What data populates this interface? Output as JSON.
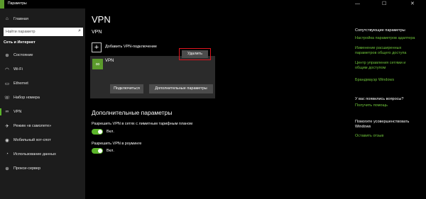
{
  "window": {
    "title": "Параметры",
    "minimize": "—",
    "maximize": "☐",
    "close": "✕"
  },
  "sidebar": {
    "home": "Главная",
    "search_placeholder": "Найти параметр",
    "section": "Сеть и Интернет",
    "items": [
      {
        "label": "Состояние",
        "icon": "globe-icon",
        "active": false
      },
      {
        "label": "Wi-Fi",
        "icon": "wifi-icon",
        "active": false
      },
      {
        "label": "Ethernet",
        "icon": "ethernet-icon",
        "active": false
      },
      {
        "label": "Набор номера",
        "icon": "phone-icon",
        "active": false
      },
      {
        "label": "VPN",
        "icon": "vpn-icon",
        "active": true
      },
      {
        "label": "Режим «в самолете»",
        "icon": "airplane-icon",
        "active": false
      },
      {
        "label": "Мобильный хот-спот",
        "icon": "hotspot-icon",
        "active": false
      },
      {
        "label": "Использование данных",
        "icon": "data-usage-icon",
        "active": false
      },
      {
        "label": "Прокси-сервер",
        "icon": "globe-icon",
        "active": false
      }
    ]
  },
  "main": {
    "title": "VPN",
    "section": "VPN",
    "add_label": "Добавить VPN-подключение",
    "connection_name": "VPN",
    "connect_btn": "Подключиться",
    "advanced_btn": "Дополнительные параметры",
    "delete_btn": "Удалить",
    "advanced_title": "Дополнительные параметры",
    "option1_label": "Разрешить VPN в сетях с лимитным тарифным планом",
    "option1_state": "Вкл.",
    "option2_label": "Разрешить VPN в роуминге",
    "option2_state": "Вкл."
  },
  "related": {
    "head": "Сопутствующие параметры",
    "link1": "Настройка параметров адаптера",
    "link2a": "Изменение расширенных",
    "link2b": "параметров общего доступа",
    "link3a": "Центр управления сетями и",
    "link3b": "общим доступом",
    "link4": "Брандмауэр Windows",
    "question": "У вас появились вопросы?",
    "help": "Получить помощь",
    "improve_a": "Помогите усовершенствовать",
    "improve_b": "Windows",
    "feedback": "Оставить отзыв"
  },
  "colors": {
    "accent": "#5bb52a",
    "link": "#6fc43a",
    "highlight": "#e0141e"
  }
}
